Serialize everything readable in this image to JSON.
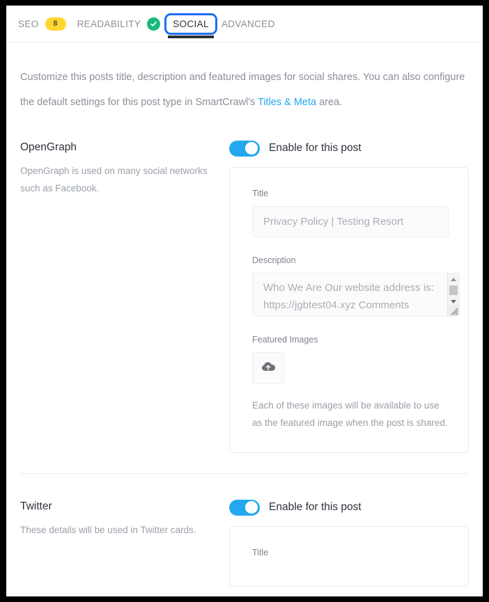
{
  "tabs": [
    {
      "label": "SEO",
      "badge": "8",
      "badge_color": "#ffd62e",
      "state": "inactive",
      "icon": "score-badge"
    },
    {
      "label": "READABILITY",
      "badge": null,
      "badge_color": "#17bb79",
      "state": "inactive",
      "icon": "check-circle-icon"
    },
    {
      "label": "SOCIAL",
      "badge": null,
      "badge_color": null,
      "state": "active-focused",
      "icon": null
    },
    {
      "label": "ADVANCED",
      "badge": null,
      "badge_color": null,
      "state": "inactive",
      "icon": null
    }
  ],
  "intro": {
    "part1": "Customize this posts title, description and featured images for social shares. You can also configure the default settings for this post type in SmartCrawl's ",
    "link": "Titles & Meta",
    "part2": " area."
  },
  "sections": [
    {
      "id": "opengraph",
      "title": "OpenGraph",
      "description": "OpenGraph is used on many social networks such as Facebook.",
      "toggle_label": "Enable for this post",
      "toggle_on": true,
      "fields": {
        "title_label": "Title",
        "title_placeholder": "Privacy Policy | Testing Resort",
        "title_value": "",
        "description_label": "Description",
        "description_value": "Who We Are Our website address is: https://jgbtest04.xyz Comments When visitors leave",
        "featured_label": "Featured Images",
        "upload_icon": "cloud-upload-icon",
        "helper": "Each of these images will be available to use as the featured image when the post is shared."
      }
    },
    {
      "id": "twitter",
      "title": "Twitter",
      "description": "These details will be used in Twitter cards.",
      "toggle_label": "Enable for this post",
      "toggle_on": true,
      "fields": {
        "title_label": "Title"
      }
    }
  ],
  "colors": {
    "accent_blue": "#23a8ef",
    "focus_blue": "#1a6ff5",
    "badge_yellow": "#ffd62e",
    "success_green": "#17bb79",
    "text_dark": "#2d3239",
    "text_muted": "#9aa0a8"
  }
}
